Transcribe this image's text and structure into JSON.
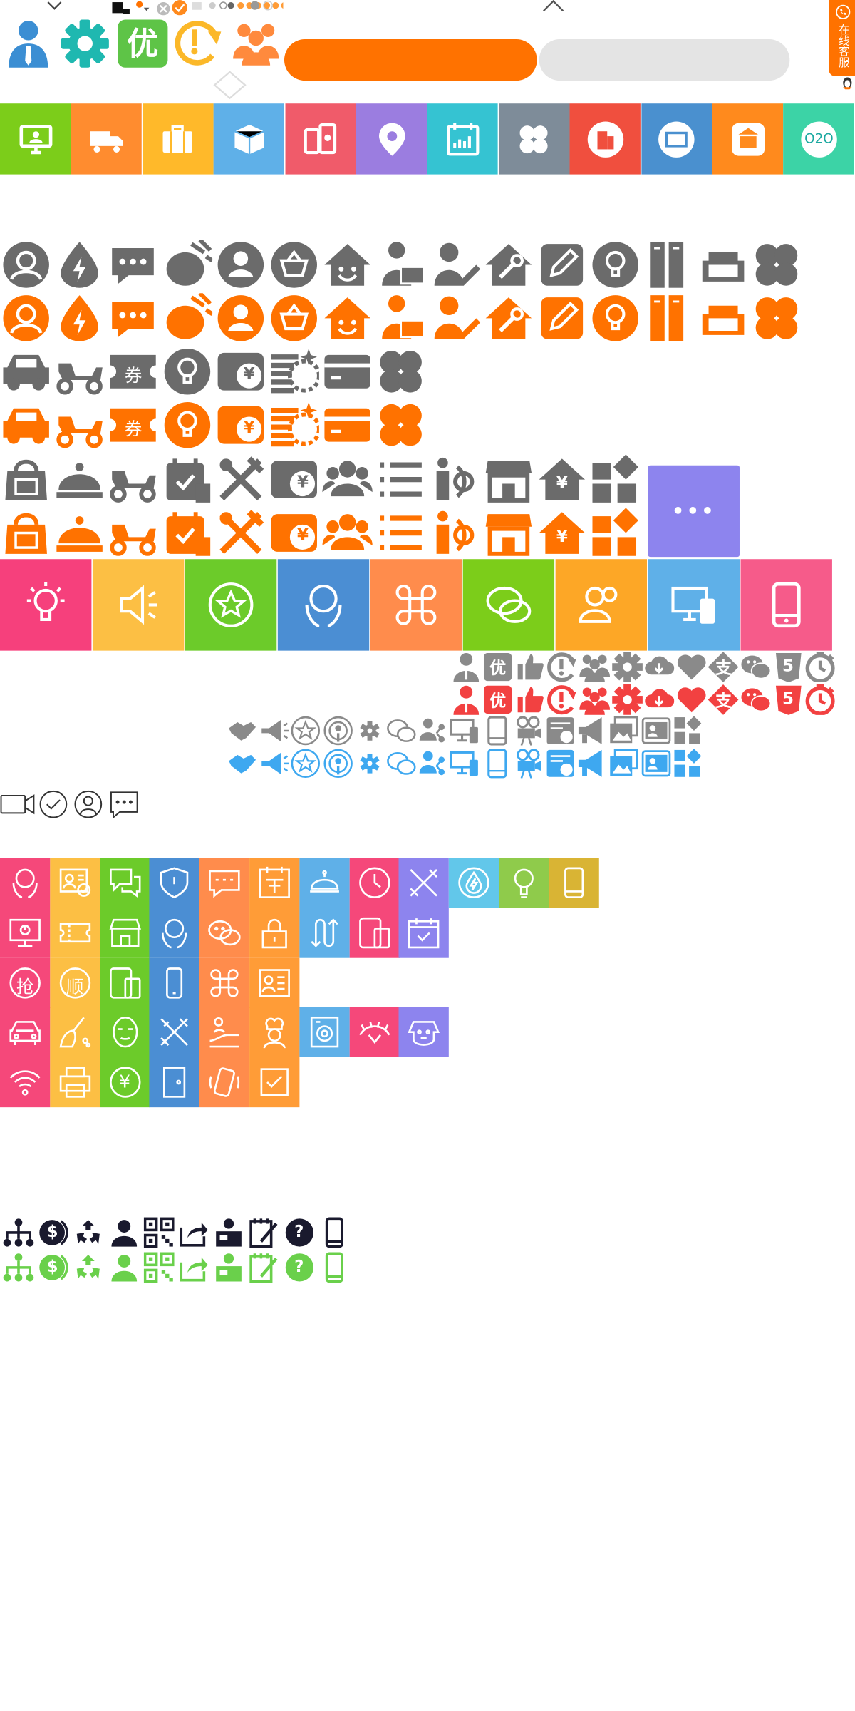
{
  "header": {
    "badge_you_label": "优",
    "orange_pill_label": "",
    "gray_pill_label": ""
  },
  "side_tab": {
    "label": "在线客服"
  },
  "colorful_row_1": {
    "colors": [
      "#7ccd1a",
      "#ff8c2f",
      "#ffb92a",
      "#5fb0e8",
      "#f05b6a",
      "#9b7de0",
      "#35c3d2",
      "#7e8c99",
      "#f04f3e",
      "#4a90cf",
      "#ff8a1d",
      "#3cd3a6"
    ],
    "o2o_label": "O2O"
  },
  "gray_orange_rows": {
    "gray": "#6b6b6b",
    "orange": "#ff7200",
    "quan_label": "券",
    "yen_label": "¥"
  },
  "purple_more_tile": {
    "color": "#8d84ee",
    "label": "•••"
  },
  "colorful_row_2": {
    "colors": [
      "#f6407c",
      "#fcbf44",
      "#6ccb2a",
      "#4b8ed3",
      "#ff8c4c",
      "#7ccd1a",
      "#fda726",
      "#5fb0e8",
      "#f65b8a"
    ]
  },
  "red_small_row": {
    "gray": "#8a8a8a",
    "red": "#f24141",
    "you_label": "优",
    "zhi_label": "支",
    "h5_label": "5"
  },
  "blue_small_row": {
    "gray": "#8a8a8a",
    "blue": "#3ea8f0"
  },
  "outline_icons": {},
  "grid_icons": {
    "col_colors": [
      "#f5487a",
      "#fcbf44",
      "#6ccb2a",
      "#4b8ed3",
      "#ff8c4c",
      "#ff9c37",
      "#5fb0e8",
      "#f5487a",
      "#8d84ee",
      "#62c7ea",
      "#8fcb4b",
      "#d9b434"
    ],
    "qiang_label": "抢",
    "shun_label": "顺",
    "quan_label": "券",
    "yen_label": "¥"
  },
  "bottom_rows": {
    "dark": "#1a1a2e",
    "green": "#6ad04b",
    "dollar_label": "$",
    "question_label": "?"
  }
}
